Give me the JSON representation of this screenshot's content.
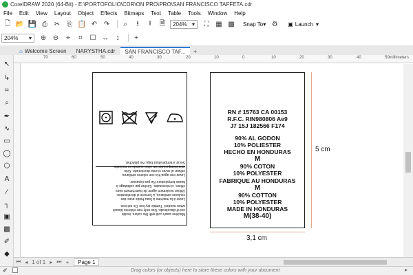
{
  "app": {
    "title": "CorelDRAW 2020 (64-Bit) - E:\\PORTOFOLIO\\CDR\\ON PRO\\PRO\\SAN FRANCISCO TAFFETA.cdr"
  },
  "menubar": {
    "items": [
      "File",
      "Edit",
      "View",
      "Layout",
      "Object",
      "Effects",
      "Bitmaps",
      "Text",
      "Table",
      "Tools",
      "Window",
      "Help"
    ]
  },
  "toolbar": {
    "zoom_value": "204%",
    "snap_label": "Snap To",
    "launch_label": "Launch"
  },
  "propertybar": {
    "zoom_value": "204%"
  },
  "tabs": [
    {
      "label": "Welcome Screen",
      "active": false
    },
    {
      "label": "NARYSTHA.cdr",
      "active": false
    },
    {
      "label": "SAN FRANCISCO TAF...",
      "active": true
    }
  ],
  "ruler": {
    "unit": "millimeters",
    "labels": [
      "70",
      "60",
      "50",
      "40",
      "30",
      "20",
      "10",
      "0",
      "10",
      "20",
      "30",
      "40",
      "50",
      "60"
    ]
  },
  "label_left": {
    "care_icons": [
      "wash-30-icon",
      "no-tumble-dry-icon",
      "no-bleach-icon",
      "iron-low-icon"
    ],
    "text_en": [
      "Machine wash cold with like colors, inside",
      "out of discolorate. Use only non-chlorine bleach",
      "when needed. Tumble dry low. Do not iron."
    ],
    "text_fr": [
      "Laver à la machine à l'eau froide avec des",
      "couleurs similaires, à l'envers si décoloration.",
      "Utiliser seulement agent de blanchiment sans",
      "chlore, si nécessaire. Sécher par culbutage à",
      "basse température Ne pas repasser."
    ],
    "text_es": [
      "Lavar con agua fría con colores similares,",
      "voltear al reves si esta decolorado. Solo",
      "usar blanqueador sin cloro cuando se necesite.",
      "Secar a temperatura baja. No planchar."
    ]
  },
  "label_right": {
    "lines_top": [
      "RN # 15763 CA 00153",
      "R.F.C. RIN980806 Ae9",
      "J7 15J 182566 F174"
    ],
    "lines_content": [
      "90% AL GODON",
      "10% POLIESTER",
      "HECHO EN HONDURAS",
      "M",
      "90% COTON",
      "10% POLYESTER",
      "FABRIQUE AU HONDURAS",
      "M",
      "90% COTTON",
      "10% POLYESTER",
      "MADE IN HONDURAS"
    ],
    "size_line": "M(38-40)"
  },
  "dimensions": {
    "height_label": "5 cm",
    "width_label": "3,1 cm",
    "line_color": "#e2a98f"
  },
  "pagebar": {
    "page_counter": "1 of 1",
    "page_tab": "Page 1"
  },
  "statusbar": {
    "hint": "Drag colors (or objects) here to store these colors with your document"
  },
  "colors": {
    "accent": "#2b7bd8",
    "app_icon": "#2aa84a"
  }
}
